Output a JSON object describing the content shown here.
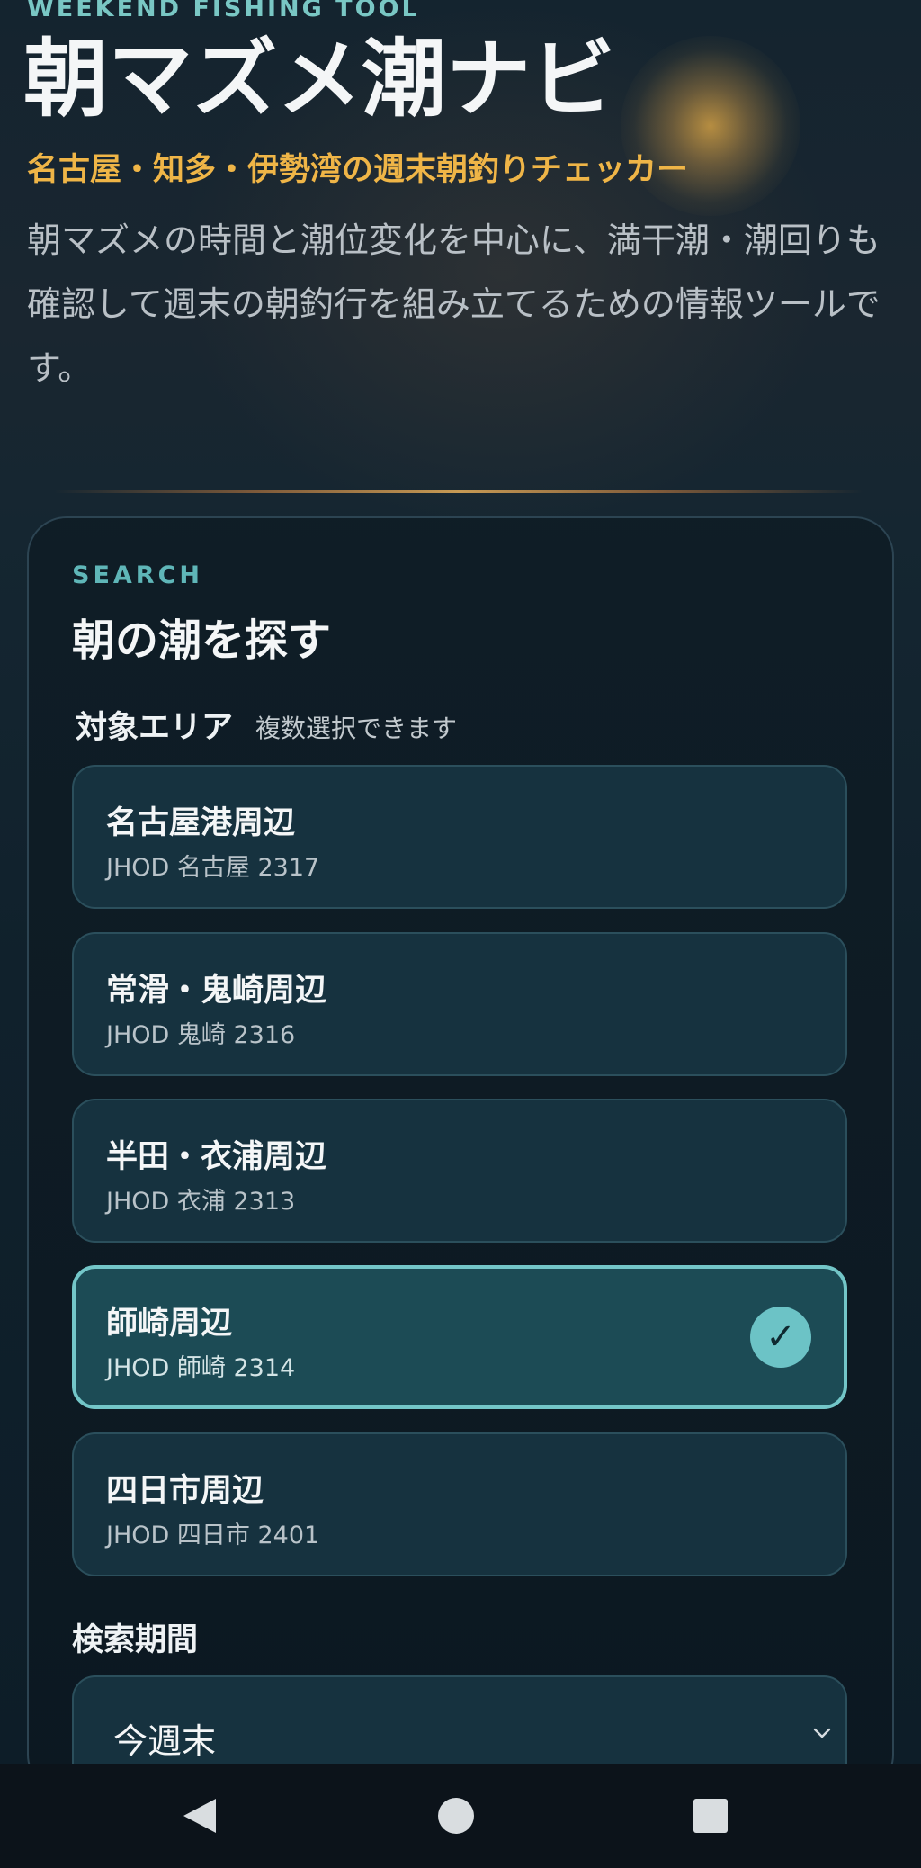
{
  "header": {
    "eyebrow": "WEEKEND FISHING TOOL",
    "title": "朝マズメ潮ナビ",
    "subtitle": "名古屋・知多・伊勢湾の週末朝釣りチェッカー",
    "description": "朝マズメの時間と潮位変化を中心に、満干潮・潮回りも確認して週末の朝釣行を組み立てるための情報ツールです。"
  },
  "search": {
    "eyebrow": "SEARCH",
    "title": "朝の潮を探す",
    "area_label": "対象エリア",
    "area_hint": "複数選択できます",
    "areas": [
      {
        "name": "名古屋港周辺",
        "station": "JHOD 名古屋 2317",
        "selected": false
      },
      {
        "name": "常滑・鬼崎周辺",
        "station": "JHOD 鬼崎 2316",
        "selected": false
      },
      {
        "name": "半田・衣浦周辺",
        "station": "JHOD 衣浦 2313",
        "selected": false
      },
      {
        "name": "師崎周辺",
        "station": "JHOD 師崎 2314",
        "selected": true
      },
      {
        "name": "四日市周辺",
        "station": "JHOD 四日市 2401",
        "selected": false
      }
    ],
    "check_mark": "✓",
    "period_label": "検索期間",
    "period_value": "今週末"
  },
  "colors": {
    "accent_teal": "#73c6c8",
    "accent_gold": "#efb547",
    "background": "#0f1d28"
  },
  "icons": {
    "nav_back": "back-triangle-icon",
    "nav_home": "home-circle-icon",
    "nav_recents": "recents-square-icon",
    "select_chevron": "chevron-down-icon"
  }
}
